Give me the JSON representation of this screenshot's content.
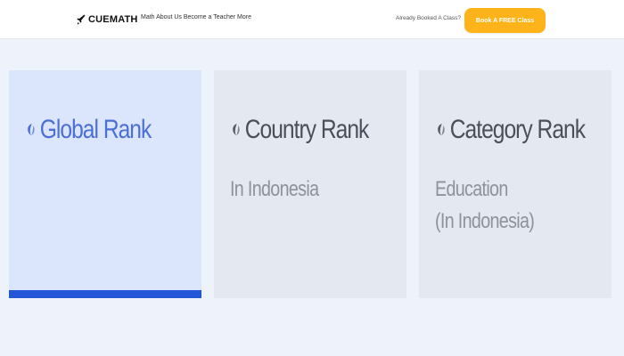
{
  "header": {
    "logo_text": "CUEMATH",
    "nav_text": "Math About Us Become a Teacher More",
    "already_text": "Already Booked A Class?",
    "book_button": "Book A FREE Class"
  },
  "cards": [
    {
      "title": "Global Rank",
      "subtitle": "",
      "subtitle2": "",
      "active": true
    },
    {
      "title": "Country Rank",
      "subtitle": "In Indonesia",
      "subtitle2": "",
      "active": false
    },
    {
      "title": "Category Rank",
      "subtitle": "Education",
      "subtitle2": "(In Indonesia)",
      "active": false
    }
  ],
  "colors": {
    "accent": "#2456d8",
    "active_title": "#4b6fd6",
    "button": "#ffb31a",
    "card_bg": "#e4e8f0",
    "active_card_bg": "#dbe5fb"
  }
}
